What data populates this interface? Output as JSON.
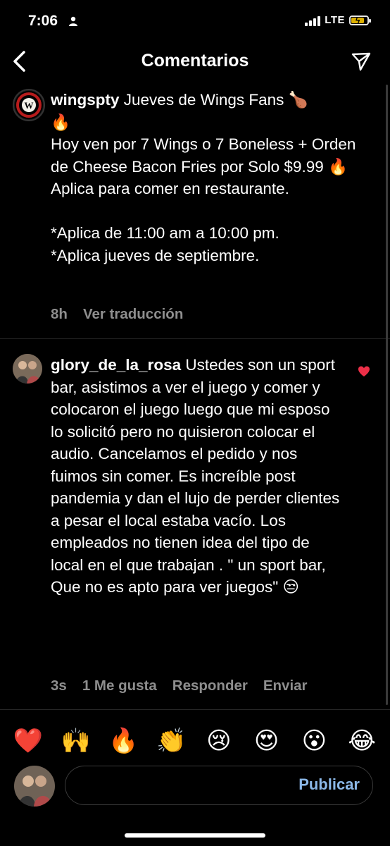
{
  "status_bar": {
    "time": "7:06",
    "network": "LTE"
  },
  "header": {
    "title": "Comentarios"
  },
  "post": {
    "username": "wingspty",
    "caption_line1": "Jueves de Wings Fans 🍗",
    "caption_line2": "🔥",
    "caption_body": "Hoy ven por 7 Wings o 7 Boneless + Orden de Cheese Bacon Fries por Solo $9.99 🔥 Aplica para comer en restaurante.",
    "caption_note1": "*Aplica de 11:00 am a 10:00 pm.",
    "caption_note2": "*Aplica jueves de septiembre.",
    "time_ago": "8h",
    "translate_label": "Ver traducción",
    "logo_letter": "W"
  },
  "comment": {
    "username": "glory_de_la_rosa",
    "text": "Ustedes son un sport bar, asistimos a ver el juego y comer y colocaron el juego luego que mi esposo lo solicitó pero no quisieron colocar el audio. Cancelamos el pedido y nos fuimos sin comer. Es increíble post pandemia y dan el lujo de perder clientes a pesar el local estaba vacío. Los empleados no tienen idea del tipo de local en el que trabajan . \" un sport bar, Que no es apto para ver juegos\" 😒",
    "time_ago": "3s",
    "likes_label": "1 Me gusta",
    "reply_label": "Responder",
    "send_label": "Enviar",
    "liked": true
  },
  "reactions": [
    "❤️",
    "🙌",
    "🔥",
    "👏",
    "😢",
    "😍",
    "😮",
    "😂"
  ],
  "composer": {
    "placeholder": "",
    "publish_label": "Publicar"
  },
  "colors": {
    "accent": "#8bb8e8",
    "heart": "#ed2f48",
    "muted": "#8e8e8e"
  },
  "icons": [
    "back-icon",
    "send-icon",
    "heart-icon",
    "person-icon",
    "signal-icon",
    "battery-icon"
  ]
}
